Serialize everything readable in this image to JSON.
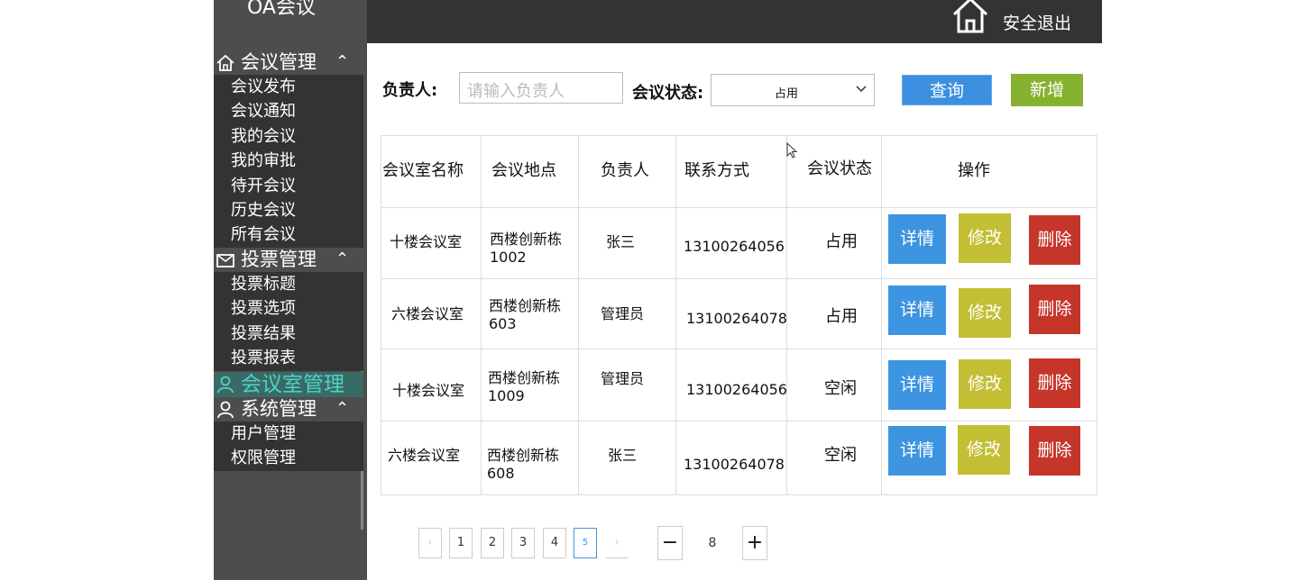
{
  "app_title": "OA会议",
  "topbar": {
    "logout_label": "安全退出"
  },
  "sidebar": {
    "groups": [
      {
        "label": "会议管理",
        "items": [
          "会议发布",
          "会议通知",
          "我的会议",
          "我的审批",
          "待开会议",
          "历史会议",
          "所有会议"
        ]
      },
      {
        "label": "投票管理",
        "items": [
          "投票标题",
          "投票选项",
          "投票结果",
          "投票报表"
        ]
      },
      {
        "label": "会议室管理",
        "items": []
      },
      {
        "label": "系统管理",
        "items": [
          "用户管理",
          "权限管理"
        ]
      }
    ],
    "expand_glyph": "⌃"
  },
  "search": {
    "owner_label": "负责人:",
    "owner_placeholder": "请输入负责人",
    "status_label": "会议状态:",
    "status_value": "占用",
    "query_label": "查询",
    "add_label": "新增"
  },
  "table": {
    "headers": [
      "会议室名称",
      "会议地点",
      "负责人",
      "联系方式",
      "会议状态",
      "操作"
    ],
    "rows": [
      {
        "name": "十楼会议室",
        "location_line1": "西楼创新栋",
        "location_line2": "1002",
        "owner": "张三",
        "phone": "13100264056",
        "status": "占用"
      },
      {
        "name": "六楼会议室",
        "location_line1": "西楼创新栋",
        "location_line2": "603",
        "owner": "管理员",
        "phone": "13100264078",
        "status": "占用"
      },
      {
        "name": "十楼会议室",
        "location_line1": "西楼创新栋",
        "location_line2": "1009",
        "owner": "管理员",
        "phone": "13100264056",
        "status": "空闲"
      },
      {
        "name": "六楼会议室",
        "location_line1": "西楼创新栋",
        "location_line2": "608",
        "owner": "张三",
        "phone": "13100264078",
        "status": "空闲"
      }
    ],
    "action_labels": {
      "detail": "详情",
      "edit": "修改",
      "delete": "删除"
    }
  },
  "pagination": {
    "prev": "‹",
    "pages": [
      "1",
      "2",
      "3",
      "4",
      "5"
    ],
    "current": "5",
    "next": "›",
    "minus": "−",
    "page_size": "8",
    "plus": "+"
  },
  "colors": {
    "topbar": "#333333",
    "sidebar": "#4d4d4d",
    "query": "#3d8fe0",
    "add": "#86b22f",
    "detail": "#3d94e0",
    "edit": "#c3bf34",
    "delete": "#c5352a",
    "active_menu": "#4fd1c5"
  },
  "icons": {
    "home": "home-icon",
    "meeting": "home-outline-icon",
    "vote": "envelope-icon",
    "room": "user-icon",
    "system": "user-icon"
  }
}
